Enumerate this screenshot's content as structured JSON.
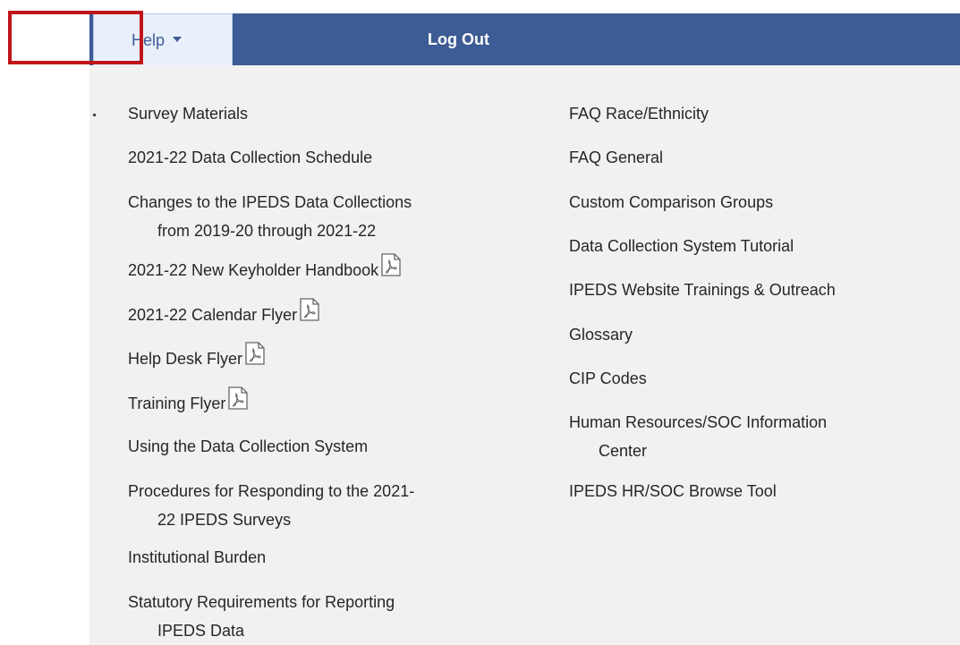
{
  "navbar": {
    "help_label": "Help",
    "logout_label": "Log Out",
    "color": "#3d5b94"
  },
  "dropdown": {
    "left_column": [
      {
        "label": "Survey Materials",
        "pdf": false
      },
      {
        "label": "2021-22 Data Collection Schedule",
        "pdf": false
      },
      {
        "line1": "Changes to the IPEDS Data Collections",
        "line2": "from 2019-20 through 2021-22",
        "pdf": false
      },
      {
        "label": "2021-22 New Keyholder Handbook",
        "pdf": true
      },
      {
        "label": "2021-22 Calendar Flyer",
        "pdf": true
      },
      {
        "label": "Help Desk Flyer",
        "pdf": true
      },
      {
        "label": "Training Flyer",
        "pdf": true
      },
      {
        "label": "Using the Data Collection System",
        "pdf": false
      },
      {
        "line1": "Procedures for Responding to the 2021-",
        "line2": "22 IPEDS Surveys",
        "pdf": false
      },
      {
        "label": "Institutional Burden",
        "pdf": false
      },
      {
        "line1": "Statutory Requirements for Reporting",
        "line2": "IPEDS Data",
        "pdf": false
      }
    ],
    "right_column": [
      {
        "label": "FAQ Race/Ethnicity"
      },
      {
        "label": "FAQ General"
      },
      {
        "label": "Custom Comparison Groups"
      },
      {
        "label": "Data Collection System Tutorial"
      },
      {
        "label": "IPEDS Website Trainings & Outreach"
      },
      {
        "label": "Glossary"
      },
      {
        "label": "CIP Codes"
      },
      {
        "line1": "Human Resources/SOC Information",
        "line2": "Center"
      },
      {
        "label": "IPEDS HR/SOC Browse Tool"
      }
    ]
  },
  "icons": {
    "pdf": "pdf-file-icon",
    "caret": "caret-down-icon"
  },
  "highlight_color": "#c0141b"
}
